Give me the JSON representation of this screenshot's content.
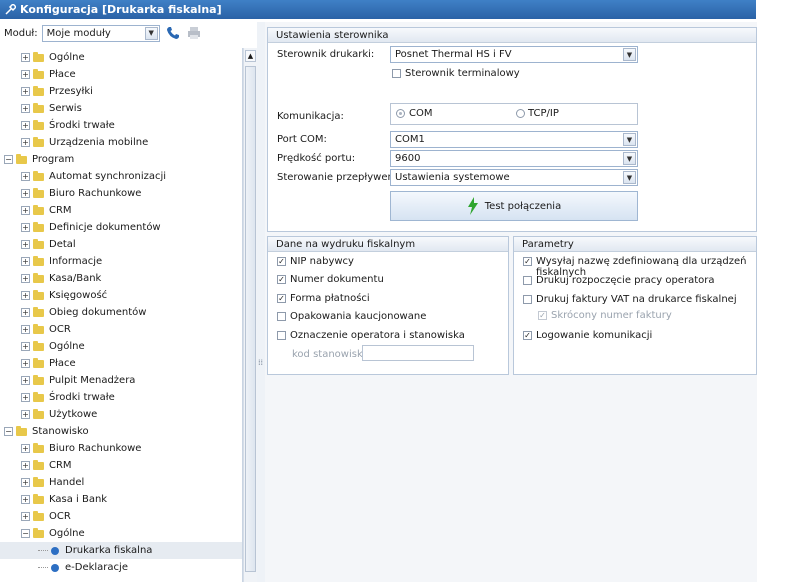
{
  "window": {
    "title": "Konfiguracja [Drukarka fiskalna]"
  },
  "module_bar": {
    "label": "Moduł:",
    "selected": "Moje moduły"
  },
  "tree": [
    {
      "label": "Ogólne",
      "type": "folder",
      "level": 1,
      "exp": "+"
    },
    {
      "label": "Płace",
      "type": "folder",
      "level": 1,
      "exp": "+"
    },
    {
      "label": "Przesyłki",
      "type": "folder",
      "level": 1,
      "exp": "+"
    },
    {
      "label": "Serwis",
      "type": "folder",
      "level": 1,
      "exp": "+"
    },
    {
      "label": "Środki trwałe",
      "type": "folder",
      "level": 1,
      "exp": "+"
    },
    {
      "label": "Urządzenia mobilne",
      "type": "folder",
      "level": 1,
      "exp": "+"
    },
    {
      "label": "Program",
      "type": "folder",
      "level": 0,
      "exp": "−"
    },
    {
      "label": "Automat synchronizacji",
      "type": "folder",
      "level": 1,
      "exp": "+"
    },
    {
      "label": "Biuro Rachunkowe",
      "type": "folder",
      "level": 1,
      "exp": "+"
    },
    {
      "label": "CRM",
      "type": "folder",
      "level": 1,
      "exp": "+"
    },
    {
      "label": "Definicje dokumentów",
      "type": "folder",
      "level": 1,
      "exp": "+"
    },
    {
      "label": "Detal",
      "type": "folder",
      "level": 1,
      "exp": "+"
    },
    {
      "label": "Informacje",
      "type": "folder",
      "level": 1,
      "exp": "+"
    },
    {
      "label": "Kasa/Bank",
      "type": "folder",
      "level": 1,
      "exp": "+"
    },
    {
      "label": "Księgowość",
      "type": "folder",
      "level": 1,
      "exp": "+"
    },
    {
      "label": "Obieg dokumentów",
      "type": "folder",
      "level": 1,
      "exp": "+"
    },
    {
      "label": "OCR",
      "type": "folder",
      "level": 1,
      "exp": "+"
    },
    {
      "label": "Ogólne",
      "type": "folder",
      "level": 1,
      "exp": "+"
    },
    {
      "label": "Płace",
      "type": "folder",
      "level": 1,
      "exp": "+"
    },
    {
      "label": "Pulpit Menadżera",
      "type": "folder",
      "level": 1,
      "exp": "+"
    },
    {
      "label": "Środki trwałe",
      "type": "folder",
      "level": 1,
      "exp": "+"
    },
    {
      "label": "Użytkowe",
      "type": "folder",
      "level": 1,
      "exp": "+"
    },
    {
      "label": "Stanowisko",
      "type": "folder",
      "level": 0,
      "exp": "−"
    },
    {
      "label": "Biuro Rachunkowe",
      "type": "folder",
      "level": 1,
      "exp": "+"
    },
    {
      "label": "CRM",
      "type": "folder",
      "level": 1,
      "exp": "+"
    },
    {
      "label": "Handel",
      "type": "folder",
      "level": 1,
      "exp": "+"
    },
    {
      "label": "Kasa i Bank",
      "type": "folder",
      "level": 1,
      "exp": "+"
    },
    {
      "label": "OCR",
      "type": "folder",
      "level": 1,
      "exp": "+"
    },
    {
      "label": "Ogólne",
      "type": "folder",
      "level": 1,
      "exp": "−"
    },
    {
      "label": "Drukarka fiskalna",
      "type": "leaf",
      "level": 2,
      "selected": true
    },
    {
      "label": "e-Deklaracje",
      "type": "leaf",
      "level": 2
    }
  ],
  "ustawienia": {
    "header": "Ustawienia sterownika",
    "sterownik_label": "Sterownik drukarki:",
    "sterownik_value": "Posnet Thermal HS i FV",
    "terminal_label": "Sterownik terminalowy",
    "terminal_checked": false,
    "komunikacja_label": "Komunikacja:",
    "com_label": "COM",
    "tcp_label": "TCP/IP",
    "port_label": "Port COM:",
    "port_value": "COM1",
    "speed_label": "Prędkość portu:",
    "speed_value": "9600",
    "flow_label": "Sterowanie przepływem:",
    "flow_value": "Ustawienia systemowe",
    "test_button": "Test połączenia"
  },
  "dane": {
    "header": "Dane na wydruku fiskalnym",
    "items": [
      {
        "label": "NIP nabywcy",
        "checked": true
      },
      {
        "label": "Numer dokumentu",
        "checked": true
      },
      {
        "label": "Forma płatności",
        "checked": true
      },
      {
        "label": "Opakowania kaucjonowane",
        "checked": false
      },
      {
        "label": "Oznaczenie operatora i stanowiska",
        "checked": false
      }
    ],
    "kod_label": "kod stanowiska:",
    "kod_value": ""
  },
  "parametry": {
    "header": "Parametry",
    "items": [
      {
        "label": "Wysyłaj nazwę zdefiniowaną dla urządzeń fiskalnych",
        "checked": true
      },
      {
        "label": "Drukuj rozpoczęcie pracy operatora",
        "checked": false
      },
      {
        "label": "Drukuj faktury VAT na drukarce fiskalnej",
        "checked": false
      },
      {
        "label": "Skrócony numer faktury",
        "checked": true,
        "disabled": true
      },
      {
        "label": "Logowanie komunikacji",
        "checked": true
      }
    ]
  },
  "colors": {
    "title_bar": "#2f6cb3",
    "folder": "#e8c84a",
    "leaf_bullet": "#2d6fc3",
    "accent_bolt": "#2fa52f"
  }
}
